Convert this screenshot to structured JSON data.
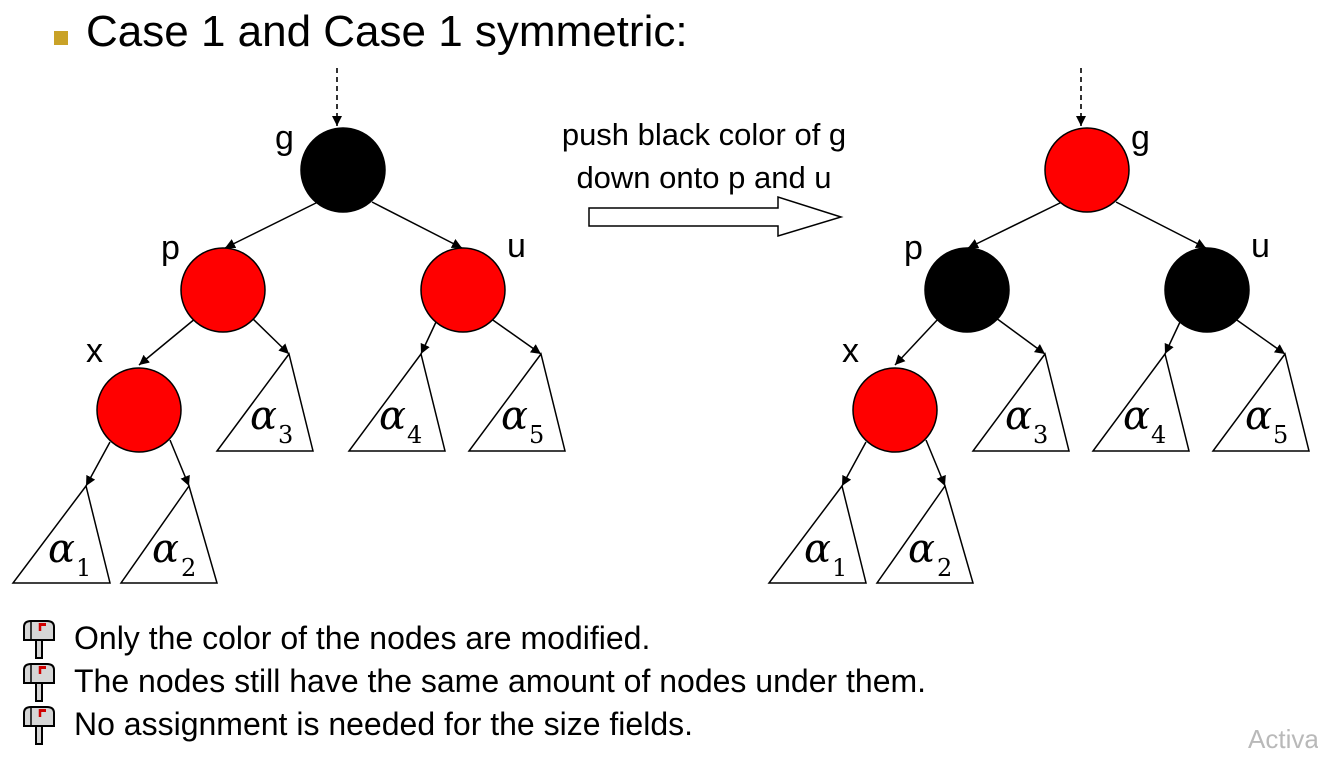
{
  "heading": "Case 1 and Case 1 symmetric:",
  "transition": {
    "line1": "push black color of g",
    "line2": "down onto p and u"
  },
  "colors": {
    "red": "#ff0000",
    "black": "#000000",
    "bullet": "#c9a227"
  },
  "trees": [
    {
      "id": "before",
      "nodes": [
        {
          "label": "g",
          "color": "black"
        },
        {
          "label": "p",
          "color": "red"
        },
        {
          "label": "u",
          "color": "red"
        },
        {
          "label": "x",
          "color": "red"
        }
      ],
      "subtrees": [
        {
          "symbol": "α",
          "sub": "1"
        },
        {
          "symbol": "α",
          "sub": "2"
        },
        {
          "symbol": "α",
          "sub": "3"
        },
        {
          "symbol": "α",
          "sub": "4"
        },
        {
          "symbol": "α",
          "sub": "5"
        }
      ]
    },
    {
      "id": "after",
      "nodes": [
        {
          "label": "g",
          "color": "red"
        },
        {
          "label": "p",
          "color": "black"
        },
        {
          "label": "u",
          "color": "black"
        },
        {
          "label": "x",
          "color": "red"
        }
      ],
      "subtrees": [
        {
          "symbol": "α",
          "sub": "1"
        },
        {
          "symbol": "α",
          "sub": "2"
        },
        {
          "symbol": "α",
          "sub": "3"
        },
        {
          "symbol": "α",
          "sub": "4"
        },
        {
          "symbol": "α",
          "sub": "5"
        }
      ]
    }
  ],
  "notes": [
    "Only the color of the nodes are modified.",
    "The nodes still have the same amount of nodes under them.",
    "No assignment is needed for the size fields."
  ],
  "note_icon": "mailbox-icon",
  "watermark": "Activa"
}
